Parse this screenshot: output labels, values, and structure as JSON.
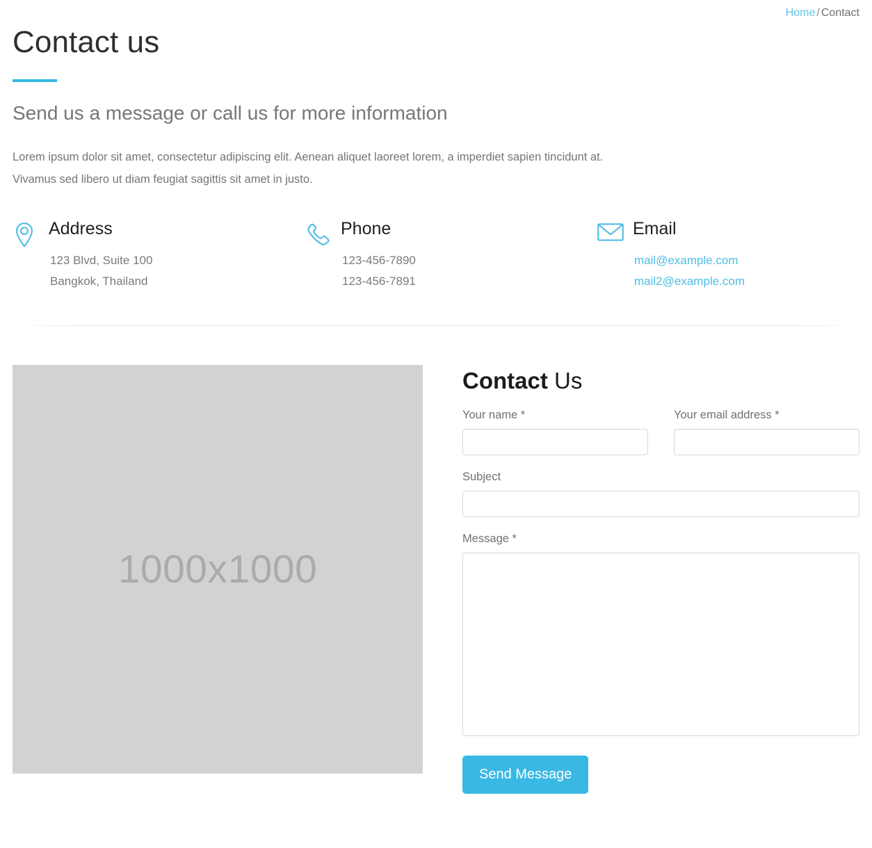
{
  "breadcrumb": {
    "home_label": "Home",
    "separator": "/",
    "current_label": "Contact"
  },
  "header": {
    "title": "Contact us",
    "subheading": "Send us a message or call us for more information",
    "paragraph": "Lorem ipsum dolor sit amet, consectetur adipiscing elit. Aenean aliquet laoreet lorem, a imperdiet sapien tincidunt at. Vivamus sed libero ut diam feugiat sagittis sit amet in justo.",
    "accent_color": "#35b7e5"
  },
  "contact_info": {
    "address": {
      "icon": "map-pin-icon",
      "title": "Address",
      "line1": "123  Blvd, Suite 100",
      "line2": "Bangkok, Thailand"
    },
    "phone": {
      "icon": "phone-icon",
      "title": "Phone",
      "line1": "123-456-7890",
      "line2": "123-456-7891"
    },
    "email": {
      "icon": "envelope-icon",
      "title": "Email",
      "line1": "mail@example.com",
      "line2": "mail2@example.com",
      "link_color": "#4fbde4"
    }
  },
  "media": {
    "placeholder_label": "1000x1000",
    "background_color": "#d2d2d2"
  },
  "form": {
    "title_bold": "Contact",
    "title_light": " Us",
    "fields": {
      "name": {
        "label": "Your name *",
        "value": "",
        "placeholder": ""
      },
      "email": {
        "label": "Your email address *",
        "value": "",
        "placeholder": ""
      },
      "subject": {
        "label": "Subject",
        "value": "",
        "placeholder": ""
      },
      "message": {
        "label": "Message *",
        "value": "",
        "placeholder": ""
      }
    },
    "submit_label": "Send Message",
    "submit_color": "#3ab8e4"
  }
}
